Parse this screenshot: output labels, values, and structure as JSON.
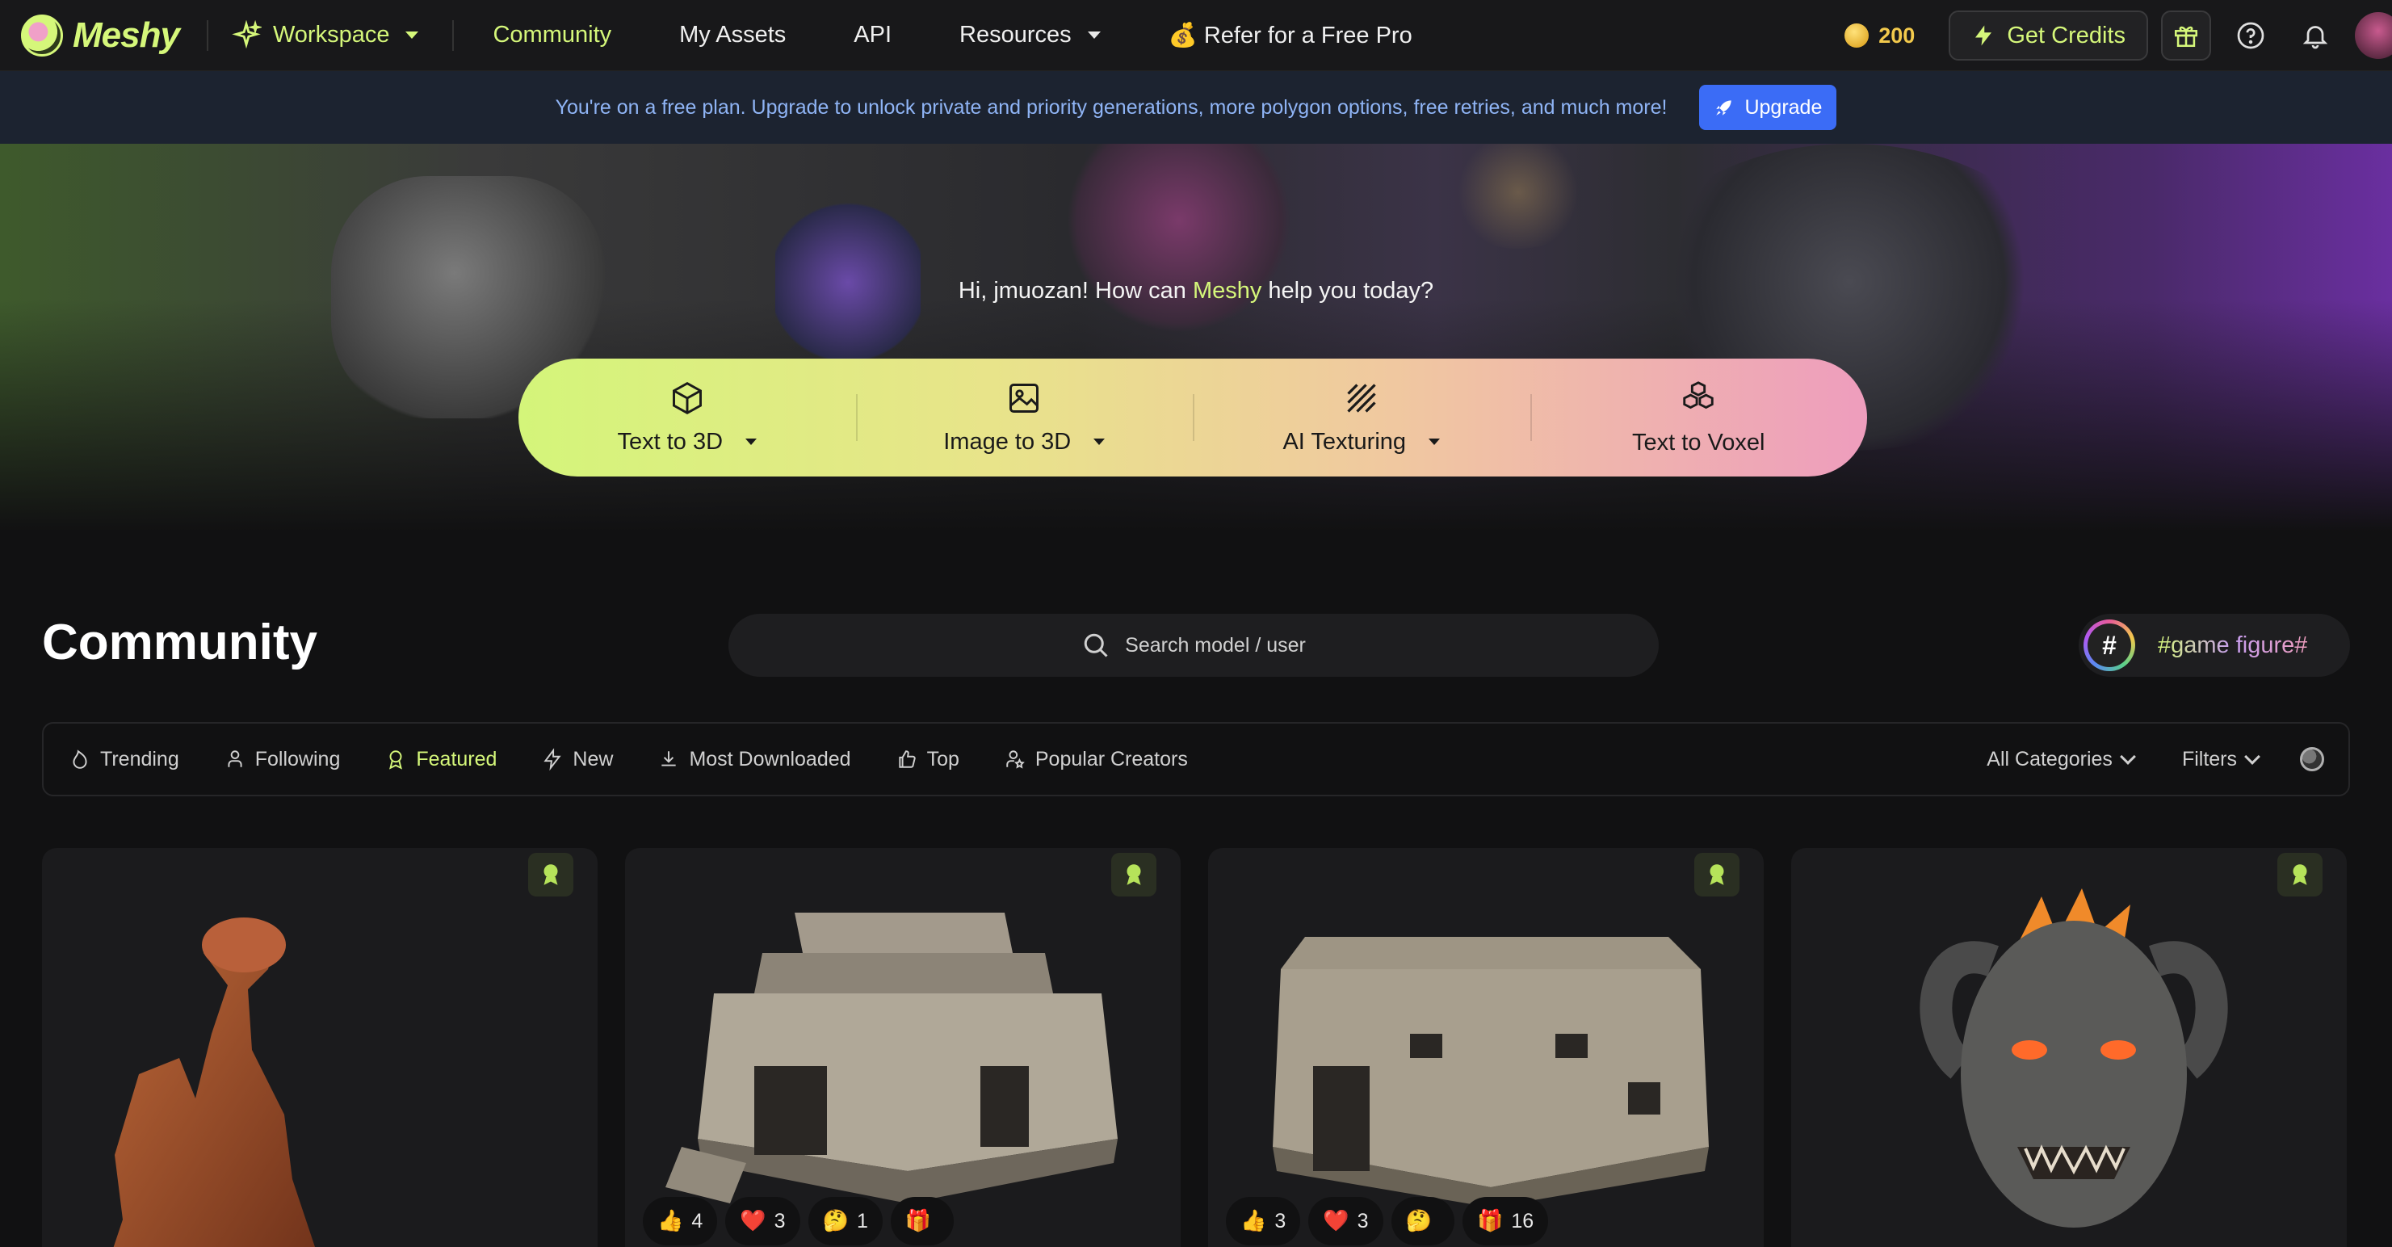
{
  "nav": {
    "logo": "Meshy",
    "workspace": "Workspace",
    "items": [
      {
        "label": "Community"
      },
      {
        "label": "My Assets"
      },
      {
        "label": "API"
      },
      {
        "label": "Resources"
      }
    ],
    "refer": "💰 Refer for a Free Pro",
    "credits": "200",
    "get_credits": "Get Credits"
  },
  "banner": {
    "text": "You're on a free plan. Upgrade to unlock private and priority generations, more polygon options, free retries, and much more!",
    "upgrade": "Upgrade"
  },
  "hero": {
    "greet_prefix": "Hi, jmuozan! How can ",
    "greet_brand": "Meshy",
    "greet_suffix": " help you today?",
    "modes": [
      {
        "label": "Text to 3D",
        "icon": "cube-icon"
      },
      {
        "label": "Image to 3D",
        "icon": "image-icon"
      },
      {
        "label": "AI Texturing",
        "icon": "texture-icon"
      },
      {
        "label": "Text to Voxel",
        "icon": "voxel-icon"
      }
    ]
  },
  "community": {
    "title": "Community",
    "search_placeholder": "Search model / user",
    "tag_icon": "#",
    "tag": "#game figure#"
  },
  "filters": {
    "tabs": [
      {
        "label": "Trending",
        "icon": "flame-icon"
      },
      {
        "label": "Following",
        "icon": "user-icon"
      },
      {
        "label": "Featured",
        "icon": "award-icon"
      },
      {
        "label": "New",
        "icon": "bolt-icon"
      },
      {
        "label": "Most Downloaded",
        "icon": "download-icon"
      },
      {
        "label": "Top",
        "icon": "thumbs-up-icon"
      },
      {
        "label": "Popular Creators",
        "icon": "user-star-icon"
      }
    ],
    "categories": "All Categories",
    "filters": "Filters"
  },
  "cards": [
    {
      "model": "red rock formation",
      "reactions": []
    },
    {
      "model": "stone temple",
      "reactions": [
        {
          "emoji": "👍",
          "count": "4"
        },
        {
          "emoji": "❤️",
          "count": "3"
        },
        {
          "emoji": "🤔",
          "count": "1"
        },
        {
          "emoji": "🎁",
          "count": ""
        }
      ]
    },
    {
      "model": "stone ruin",
      "reactions": [
        {
          "emoji": "👍",
          "count": "3"
        },
        {
          "emoji": "❤️",
          "count": "3"
        },
        {
          "emoji": "🤔",
          "count": ""
        },
        {
          "emoji": "🎁",
          "count": "16"
        }
      ]
    },
    {
      "model": "horned demon head",
      "reactions": []
    }
  ],
  "colors": {
    "accent": "#d5f77a",
    "banner_text": "#8fb4f5",
    "upgrade": "#3b6cf6",
    "credits": "#f2c94c"
  }
}
